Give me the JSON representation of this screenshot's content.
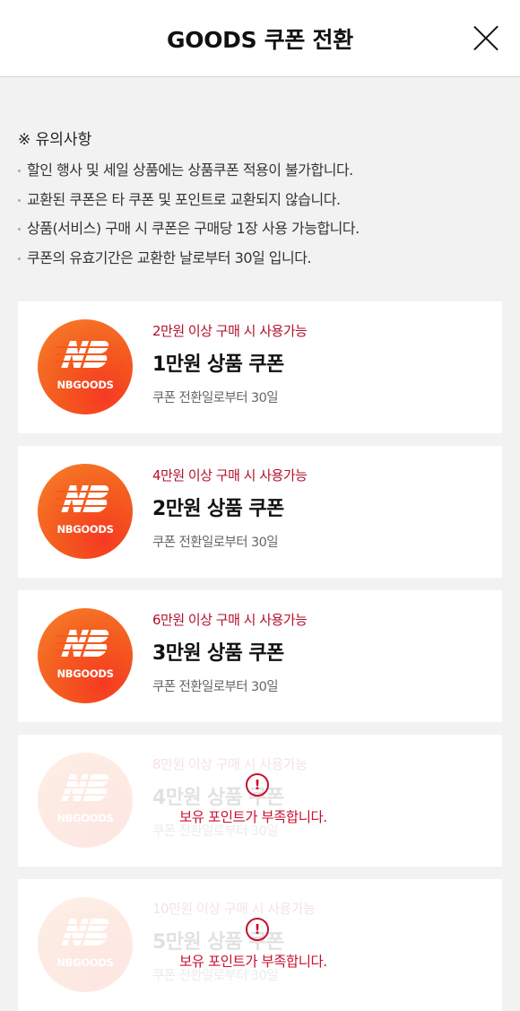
{
  "header": {
    "title": "GOODS 쿠폰 전환",
    "close_icon": "close-icon"
  },
  "notice": {
    "title": "※ 유의사항",
    "items": [
      "할인 행사 및 세일 상품에는 상품쿠폰 적용이 불가합니다.",
      "교환된 쿠폰은 타 쿠폰 및 포인트로 교환되지 않습니다.",
      "상품(서비스) 구매 시 쿠폰은 구매당 1장 사용 가능합니다.",
      "쿠폰의 유효기간은 교환한 날로부터 30일 입니다."
    ]
  },
  "coupons": [
    {
      "condition": "2만원 이상 구매 시 사용가능",
      "name": "1만원 상품 쿠폰",
      "validity": "쿠폰 전환일로부터 30일",
      "logo_text": "NBGOODS",
      "disabled": false,
      "warning": ""
    },
    {
      "condition": "4만원 이상 구매 시 사용가능",
      "name": "2만원 상품 쿠폰",
      "validity": "쿠폰 전환일로부터 30일",
      "logo_text": "NBGOODS",
      "disabled": false,
      "warning": ""
    },
    {
      "condition": "6만원 이상 구매 시 사용가능",
      "name": "3만원 상품 쿠폰",
      "validity": "쿠폰 전환일로부터 30일",
      "logo_text": "NBGOODS",
      "disabled": false,
      "warning": ""
    },
    {
      "condition": "8만원 이상 구매 시 사용가능",
      "name": "4만원 상품 쿠폰",
      "validity": "쿠폰 전환일로부터 30일",
      "logo_text": "NBGOODS",
      "disabled": true,
      "warning_icon": "!",
      "warning": "보유 포인트가 부족합니다."
    },
    {
      "condition": "10만원 이상 구매 시 사용가능",
      "name": "5만원 상품 쿠폰",
      "validity": "쿠폰 전환일로부터 30일",
      "logo_text": "NBGOODS",
      "disabled": true,
      "warning_icon": "!",
      "warning": "보유 포인트가 부족합니다."
    }
  ],
  "colors": {
    "accent": "#c8102e",
    "logo_gradient": [
      "#f63a22",
      "#f7822a"
    ],
    "background": "#f2f2f2"
  }
}
